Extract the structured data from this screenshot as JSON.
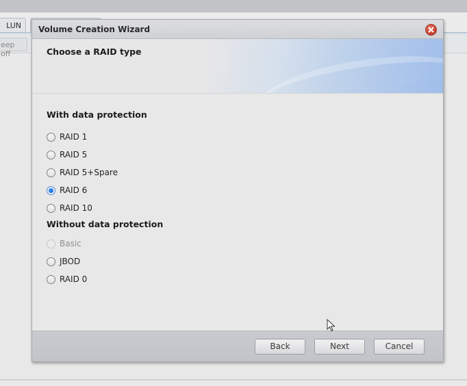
{
  "background": {
    "tabs": [
      {
        "label": "LUN"
      },
      {
        "label": ""
      }
    ],
    "toolbar_button": "eep off"
  },
  "dialog": {
    "title": "Volume Creation Wizard",
    "close_icon": "close-icon",
    "header": {
      "title": "Choose a RAID type"
    },
    "sections": [
      {
        "title": "With data protection",
        "options": [
          {
            "label": "RAID 1",
            "checked": false,
            "disabled": false
          },
          {
            "label": "RAID 5",
            "checked": false,
            "disabled": false
          },
          {
            "label": "RAID 5+Spare",
            "checked": false,
            "disabled": false
          },
          {
            "label": "RAID 6",
            "checked": true,
            "disabled": false
          },
          {
            "label": "RAID 10",
            "checked": false,
            "disabled": false
          }
        ]
      },
      {
        "title": "Without data protection",
        "options": [
          {
            "label": "Basic",
            "checked": false,
            "disabled": true
          },
          {
            "label": "JBOD",
            "checked": false,
            "disabled": false
          },
          {
            "label": "RAID 0",
            "checked": false,
            "disabled": false
          }
        ]
      }
    ],
    "selected_option": "RAID 6",
    "footer": {
      "back_label": "Back",
      "next_label": "Next",
      "cancel_label": "Cancel"
    }
  },
  "colors": {
    "accent": "#1263d6",
    "close_button": "#c53a2a"
  }
}
